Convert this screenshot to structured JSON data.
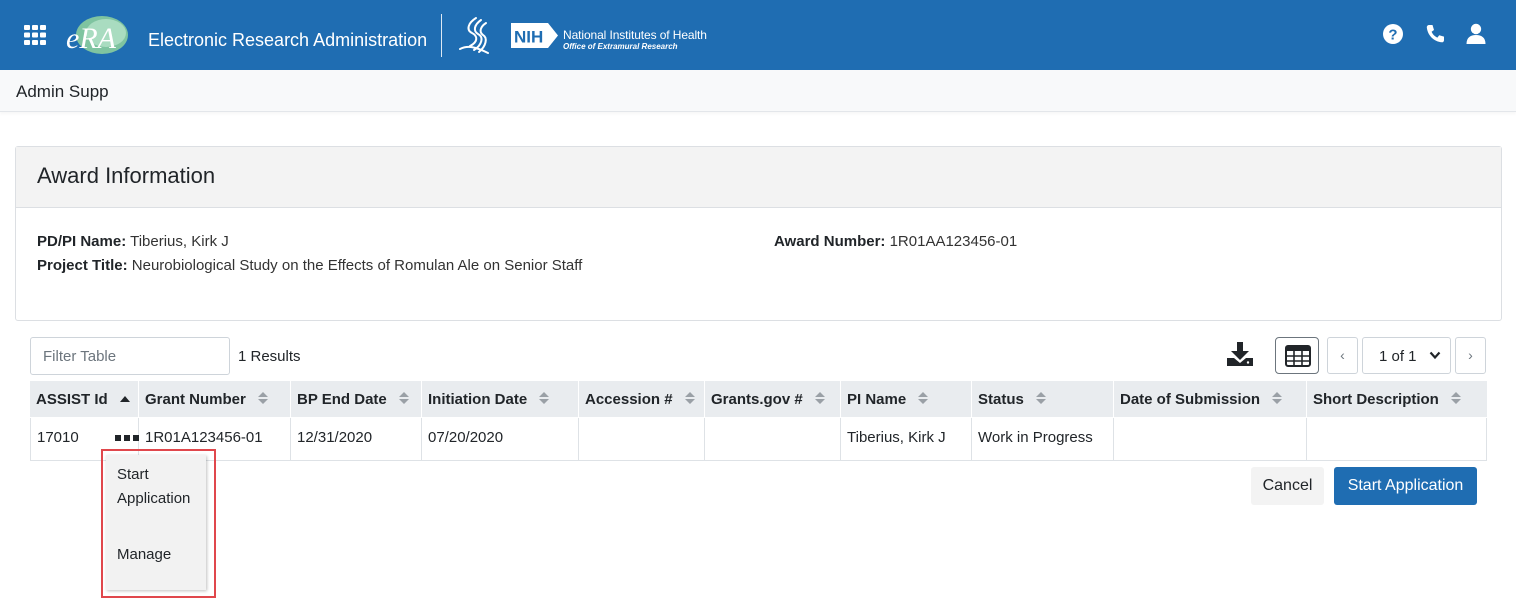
{
  "header": {
    "app_title": "Electronic Research Administration",
    "era_logo_text": "eRA",
    "nih_abbrev": "NIH",
    "nih_name": "National Institutes of Health",
    "nih_office": "Office of Extramural Research",
    "icons": [
      "apps-grid-icon",
      "help-icon",
      "phone-icon",
      "user-icon"
    ],
    "brand_color": "#1f6db2"
  },
  "subheader": {
    "title": "Admin Supp"
  },
  "award": {
    "title": "Award Information",
    "pi_label": "PD/PI Name:",
    "pi_value": "Tiberius, Kirk J",
    "project_label": "Project Title:",
    "project_value": "Neurobiological Study on the Effects of Romulan Ale on Senior Staff",
    "award_label": "Award Number:",
    "award_value": "1R01AA123456-01"
  },
  "table_tools": {
    "filter_placeholder": "Filter Table",
    "results": "1 Results",
    "page_select": "1 of 1",
    "prev": "‹",
    "next": "›"
  },
  "table": {
    "columns": [
      "ASSIST Id",
      "Grant Number",
      "BP End Date",
      "Initiation Date",
      "Accession #",
      "Grants.gov #",
      "PI Name",
      "Status",
      "Date of Submission",
      "Short Description"
    ],
    "rows": [
      [
        "17010",
        "1R01A123456-01",
        "12/31/2020",
        "07/20/2020",
        "",
        "",
        "Tiberius, Kirk J",
        "Work in Progress",
        "",
        ""
      ]
    ]
  },
  "row_menu": {
    "items": [
      "Start Application",
      "Manage"
    ],
    "highlight_color": "#e0474c"
  },
  "actions": {
    "cancel": "Cancel",
    "start": "Start Application"
  }
}
